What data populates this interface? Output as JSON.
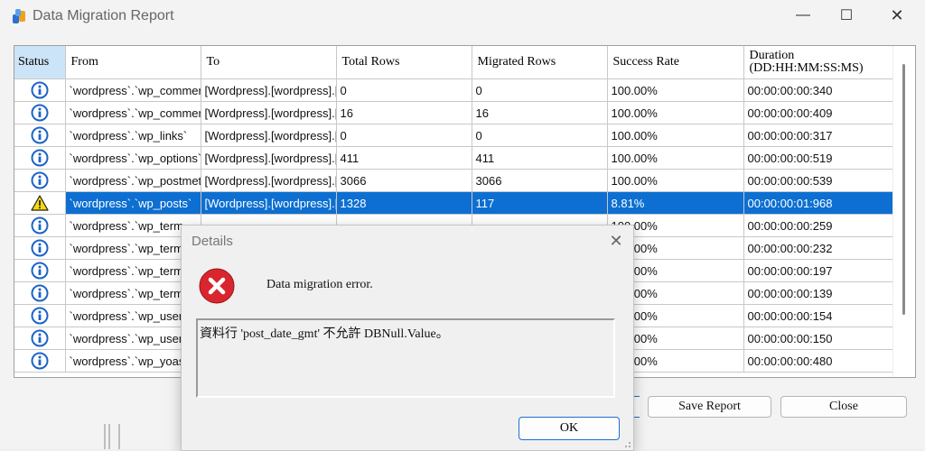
{
  "window": {
    "title": "Data Migration Report"
  },
  "grid": {
    "columns": [
      "Status",
      "From",
      "To",
      "Total Rows",
      "Migrated Rows",
      "Success Rate",
      "Duration\n(DD:HH:MM:SS:MS)"
    ],
    "rows": [
      {
        "status": "info-icon",
        "from": "`wordpress`.`wp_comment",
        "to": "[Wordpress].[wordpress].[",
        "total": "0",
        "migrated": "0",
        "rate": "100.00%",
        "duration": "00:00:00:00:340"
      },
      {
        "status": "info-icon",
        "from": "`wordpress`.`wp_comment",
        "to": "[Wordpress].[wordpress].[",
        "total": "16",
        "migrated": "16",
        "rate": "100.00%",
        "duration": "00:00:00:00:409"
      },
      {
        "status": "info-icon",
        "from": "`wordpress`.`wp_links`",
        "to": "[Wordpress].[wordpress].[",
        "total": "0",
        "migrated": "0",
        "rate": "100.00%",
        "duration": "00:00:00:00:317"
      },
      {
        "status": "info-icon",
        "from": "`wordpress`.`wp_options`",
        "to": "[Wordpress].[wordpress].[",
        "total": "411",
        "migrated": "411",
        "rate": "100.00%",
        "duration": "00:00:00:00:519"
      },
      {
        "status": "info-icon",
        "from": "`wordpress`.`wp_postmeta",
        "to": "[Wordpress].[wordpress].[",
        "total": "3066",
        "migrated": "3066",
        "rate": "100.00%",
        "duration": "00:00:00:00:539"
      },
      {
        "status": "warning-icon",
        "from": "`wordpress`.`wp_posts`",
        "to": "[Wordpress].[wordpress].[",
        "total": "1328",
        "migrated": "117",
        "rate": "8.81%",
        "duration": "00:00:00:01:968",
        "selected": true
      },
      {
        "status": "info-icon",
        "from": "`wordpress`.`wp_term_",
        "to": "",
        "total": "",
        "migrated": "",
        "rate": "100.00%",
        "duration": "00:00:00:00:259"
      },
      {
        "status": "info-icon",
        "from": "`wordpress`.`wp_term_",
        "to": "",
        "total": "",
        "migrated": "",
        "rate": "100.00%",
        "duration": "00:00:00:00:232"
      },
      {
        "status": "info-icon",
        "from": "`wordpress`.`wp_termn",
        "to": "",
        "total": "",
        "migrated": "",
        "rate": "100.00%",
        "duration": "00:00:00:00:197"
      },
      {
        "status": "info-icon",
        "from": "`wordpress`.`wp_terms",
        "to": "",
        "total": "",
        "migrated": "",
        "rate": "100.00%",
        "duration": "00:00:00:00:139"
      },
      {
        "status": "info-icon",
        "from": "`wordpress`.`wp_usem",
        "to": "",
        "total": "",
        "migrated": "",
        "rate": "100.00%",
        "duration": "00:00:00:00:154"
      },
      {
        "status": "info-icon",
        "from": "`wordpress`.`wp_users",
        "to": "",
        "total": "",
        "migrated": "",
        "rate": "100.00%",
        "duration": "00:00:00:00:150"
      },
      {
        "status": "info-icon",
        "from": "`wordpress`.`wp_yoast",
        "to": "",
        "total": "",
        "migrated": "",
        "rate": "100.00%",
        "duration": "00:00:00:00:480"
      }
    ]
  },
  "buttons": {
    "save_report": "Save Report",
    "close": "Close"
  },
  "dialog": {
    "title": "Details",
    "message": "Data migration error.",
    "detail": "資料行 'post_date_gmt' 不允許 DBNull.Value。",
    "ok": "OK"
  },
  "colors": {
    "selection": "#0d6fd1",
    "status_header": "#cce4f7",
    "error_red": "#d9262e",
    "info_blue": "#1c63c7",
    "warning_yellow": "#f5d90a"
  }
}
